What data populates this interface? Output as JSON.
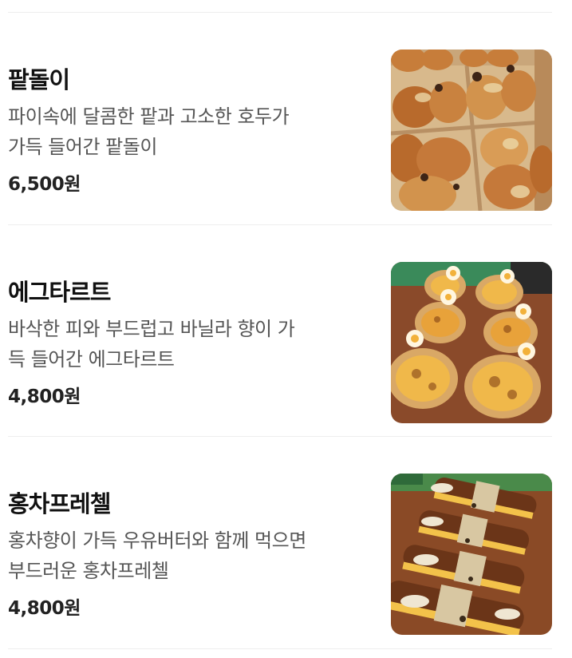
{
  "menu": {
    "items": [
      {
        "name": "팥돌이",
        "description_line1": "파이속에 달콤한 팥과 고소한 호두가",
        "description_line2": "가득 들어간 팥돌이",
        "price": "6,500원",
        "image_subject": "box-of-rolls"
      },
      {
        "name": "에그타르트",
        "description_line1": "바삭한 피와 부드럽고 바닐라 향이 가",
        "description_line2": "득 들어간 에그타르트",
        "price": "4,800원",
        "image_subject": "egg-tarts"
      },
      {
        "name": "홍차프레첼",
        "description_line1": "홍차향이 가득 우유버터와 함께 먹으면",
        "description_line2": "부드러운 홍차프레첼",
        "price": "4,800원",
        "image_subject": "pretzel-sandwiches"
      }
    ]
  }
}
